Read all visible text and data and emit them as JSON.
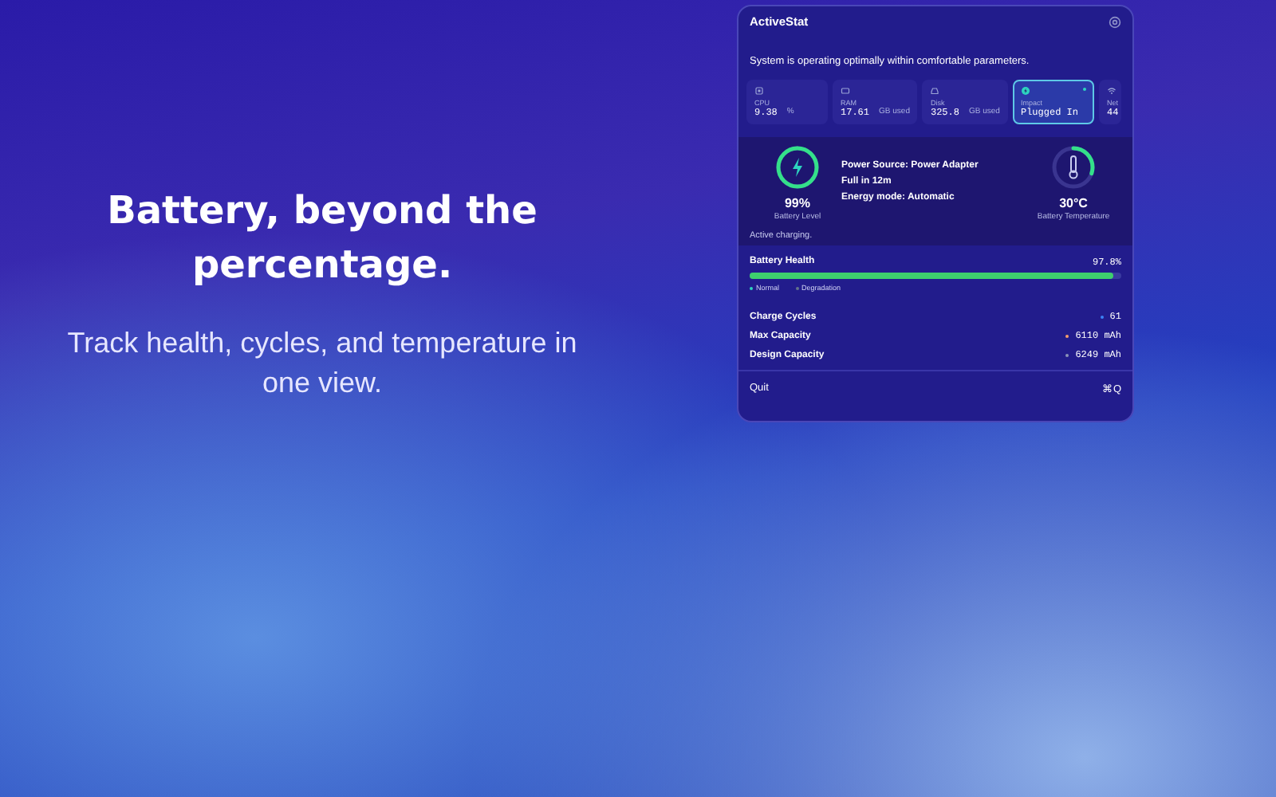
{
  "headline": "Battery, beyond the percentage.",
  "subline": "Track health, cycles, and temperature in one view.",
  "panel": {
    "title": "ActiveStat",
    "status": "System is operating optimally within comfortable parameters.",
    "tiles": [
      {
        "kind": "cpu",
        "label": "CPU",
        "value": "9.38",
        "unit": "%",
        "selected": false
      },
      {
        "kind": "ram",
        "label": "RAM",
        "value": "17.61",
        "unit": "GB used",
        "selected": false
      },
      {
        "kind": "disk",
        "label": "Disk",
        "value": "325.8",
        "unit": "GB used",
        "selected": false
      },
      {
        "kind": "impact",
        "label": "Impact",
        "value": "Plugged In",
        "selected": true
      },
      {
        "kind": "network",
        "label": "Net",
        "value": "44",
        "selected": false
      }
    ],
    "battery": {
      "percent": "99%",
      "label": "Battery Level",
      "level": 0.99
    },
    "info": [
      "Power Source: Power Adapter",
      "Full in 12m",
      "Energy mode: Automatic"
    ],
    "temperature": {
      "value": "30°C",
      "label": "Battery Temperature",
      "level": 0.3
    },
    "note": "Active charging.",
    "health": {
      "label": "Battery Health",
      "value": "97.8%",
      "level": 0.978
    },
    "legend": [
      {
        "label": "Normal",
        "color": "#2dd4bf"
      },
      {
        "label": "Degradation",
        "color": "#64748b"
      }
    ],
    "stats": [
      {
        "label": "Charge Cycles",
        "value": "61",
        "color": "#3b82f6"
      },
      {
        "label": "Max Capacity",
        "value": "6110 mAh",
        "color": "#f59e6b"
      },
      {
        "label": "Design Capacity",
        "value": "6249 mAh",
        "color": "#8b93b8"
      }
    ],
    "quit": {
      "label": "Quit",
      "shortcut": "⌘Q"
    }
  }
}
